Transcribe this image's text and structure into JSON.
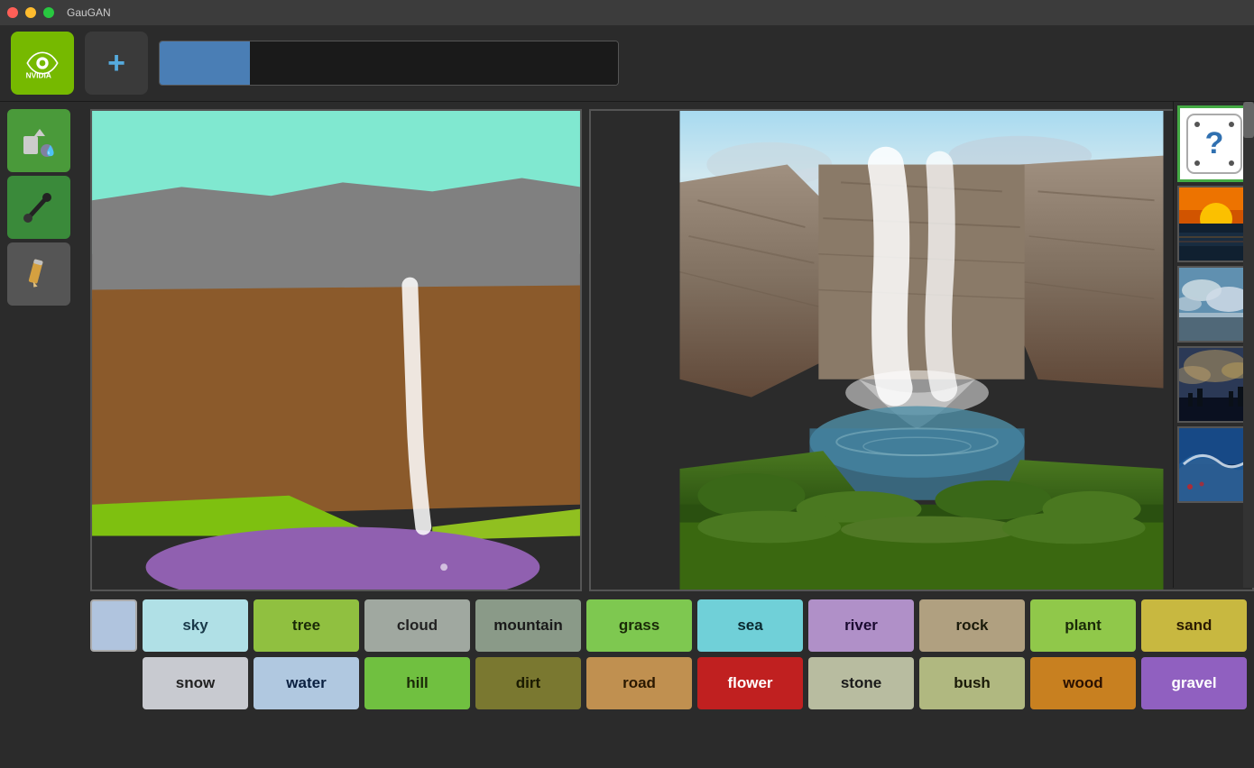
{
  "titlebar": {
    "title": "GauGAN",
    "traffic_lights": [
      "red",
      "yellow",
      "green"
    ]
  },
  "toolbar": {
    "plus_label": "+",
    "color_selected": "#4a7eb5"
  },
  "left_tools": [
    {
      "id": "fill",
      "label": "fill-icon",
      "icon": "🪣"
    },
    {
      "id": "paint",
      "label": "paint-icon",
      "icon": "🖌"
    },
    {
      "id": "pencil",
      "label": "pencil-icon",
      "icon": "✏"
    }
  ],
  "palette": {
    "active_color": "#b0c4de",
    "row1": [
      {
        "label": "sky",
        "color": "#b0e0e6"
      },
      {
        "label": "tree",
        "color": "#90c040"
      },
      {
        "label": "cloud",
        "color": "#a0a8a0"
      },
      {
        "label": "mountain",
        "color": "#8a9a88"
      },
      {
        "label": "grass",
        "color": "#7ec850"
      },
      {
        "label": "sea",
        "color": "#70d0d8"
      },
      {
        "label": "river",
        "color": "#b090c8"
      },
      {
        "label": "rock",
        "color": "#b0a080"
      },
      {
        "label": "plant",
        "color": "#90c84a"
      },
      {
        "label": "sand",
        "color": "#c8b840"
      }
    ],
    "row2": [
      {
        "label": "snow",
        "color": "#c8cad0"
      },
      {
        "label": "water",
        "color": "#b0c8e0"
      },
      {
        "label": "hill",
        "color": "#70c040"
      },
      {
        "label": "dirt",
        "color": "#7a7830"
      },
      {
        "label": "road",
        "color": "#c09050"
      },
      {
        "label": "flower",
        "color": "#c02020"
      },
      {
        "label": "stone",
        "color": "#b8bca0"
      },
      {
        "label": "bush",
        "color": "#b0b880"
      },
      {
        "label": "wood",
        "color": "#c88020"
      },
      {
        "label": "gravel",
        "color": "#9060c0"
      }
    ]
  },
  "thumbnails": [
    {
      "id": "dice",
      "label": "random-dice",
      "selected": true
    },
    {
      "id": "sunset",
      "label": "sunset-scene",
      "selected": false
    },
    {
      "id": "sky-clouds",
      "label": "sky-clouds-scene",
      "selected": false
    },
    {
      "id": "dramatic-sky",
      "label": "dramatic-sky-scene",
      "selected": false
    },
    {
      "id": "wave",
      "label": "wave-scene",
      "selected": false
    }
  ]
}
